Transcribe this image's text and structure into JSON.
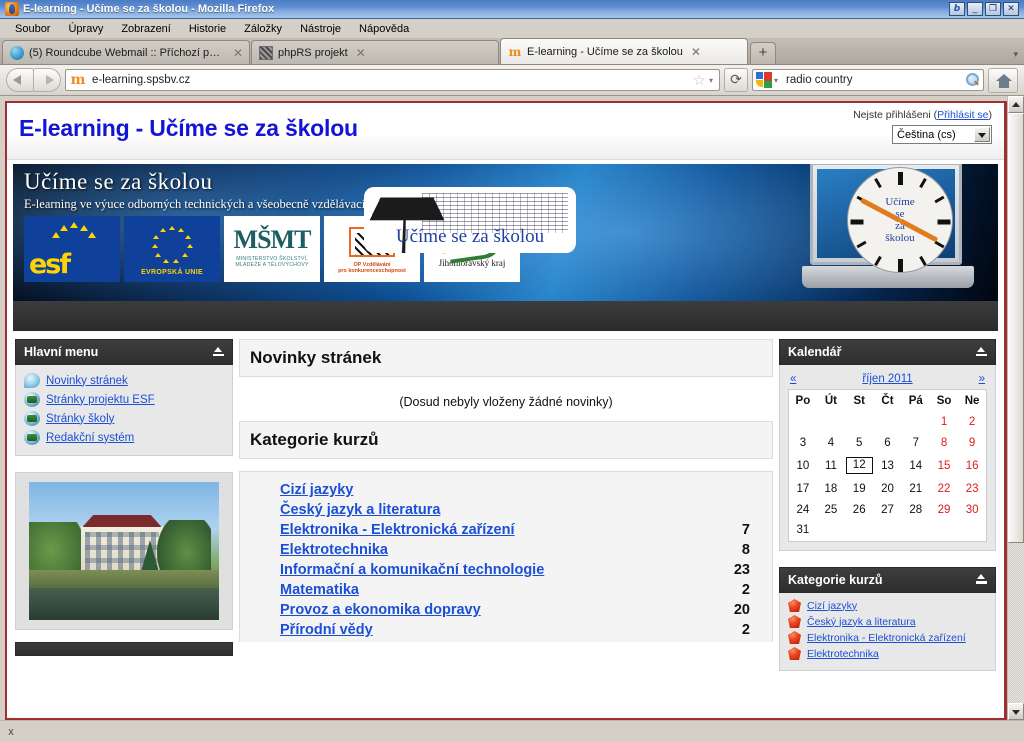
{
  "window": {
    "title": "E-learning - Učíme se za školou - Mozilla Firefox",
    "icon": "firefox-icon",
    "buttons": {
      "extra": "b",
      "minimize": "_",
      "restore": "❐",
      "close": "✕"
    }
  },
  "menubar": [
    {
      "label": "Soubor",
      "name": "menu-soubor"
    },
    {
      "label": "Úpravy",
      "name": "menu-upravy"
    },
    {
      "label": "Zobrazení",
      "name": "menu-zobrazeni"
    },
    {
      "label": "Historie",
      "name": "menu-historie"
    },
    {
      "label": "Záložky",
      "name": "menu-zalozky"
    },
    {
      "label": "Nástroje",
      "name": "menu-nastroje"
    },
    {
      "label": "Nápověda",
      "name": "menu-napoveda"
    }
  ],
  "tabs": [
    {
      "label": "(5) Roundcube Webmail :: Příchozí pošta",
      "active": false,
      "favicon": "roundcube-icon",
      "close": "✕"
    },
    {
      "label": "phpRS projekt",
      "active": false,
      "favicon": "phprs-icon",
      "close": "✕"
    },
    {
      "label": "E-learning - Učíme se za školou",
      "active": true,
      "favicon": "moodle-icon",
      "close": "✕"
    }
  ],
  "tabstrip": {
    "new_tab": "+",
    "list_all": "▾"
  },
  "toolbar": {
    "back": "◀",
    "forward": "▶",
    "url": "e-learning.spsbv.cz",
    "url_highlight": "spsbv.cz",
    "bookmark_star": "☆",
    "bookmark_caret": "▾",
    "reload": "⟳",
    "search_engine": "google-icon",
    "search_value": "radio country",
    "search_caret": "▾",
    "home": "home-icon"
  },
  "page": {
    "header": {
      "site_name": "E-learning - Učíme se za školou",
      "login_text": "Nejste přihlášeni (",
      "login_link": "Přihlásit se",
      "login_text_end": ")",
      "language": "Čeština (cs)",
      "language_caret": "▾"
    },
    "banner": {
      "title": "Učíme se za školou",
      "subtitle": "E-learning ve výuce odborných technických a všeobecně vzdělávacích předmětů na střední škole",
      "logos": [
        {
          "name": "esf-logo",
          "text": "esf"
        },
        {
          "name": "eu-logo",
          "text": "EVROPSKÁ UNIE"
        },
        {
          "name": "msmt-logo",
          "line1": "MINISTERSTVO ŠKOLSTVÍ,",
          "line2": "MLÁDEŽE A TĚLOVÝCHOVY",
          "mark": "MŠMT"
        },
        {
          "name": "opvk-logo",
          "line1": "OP Vzdělávání",
          "line2": "pro konkurenceschopnost"
        },
        {
          "name": "jmk-logo",
          "text": "Jihomoravský kraj"
        }
      ],
      "plaque_text": "Učíme se za školou",
      "clock_lines": [
        "Učíme",
        "se",
        "za",
        "školou"
      ]
    },
    "main_menu_block": {
      "title": "Hlavní menu",
      "dock": "dock-icon",
      "items": [
        {
          "label": "Novinky stránek",
          "icon": "news-icon"
        },
        {
          "label": "Stránky projektu ESF",
          "icon": "link-icon"
        },
        {
          "label": "Stránky školy",
          "icon": "link-icon"
        },
        {
          "label": "Redakční systém",
          "icon": "link-icon"
        }
      ]
    },
    "photo_block": {
      "alt": "school-photo"
    },
    "partial_block": {
      "title": ""
    },
    "news": {
      "title": "Novinky stránek",
      "empty_text": "(Dosud nebyly vloženy žádné novinky)"
    },
    "categories": {
      "title": "Kategorie kurzů",
      "rows": [
        {
          "label": "Cizí jazyky",
          "count": ""
        },
        {
          "label": "Český jazyk a literatura",
          "count": ""
        },
        {
          "label": "Elektronika - Elektronická zařízení",
          "count": "7"
        },
        {
          "label": "Elektrotechnika",
          "count": "8"
        },
        {
          "label": "Informační a komunikační technologie",
          "count": "23"
        },
        {
          "label": "Matematika",
          "count": "2"
        },
        {
          "label": "Provoz a ekonomika dopravy",
          "count": "20"
        },
        {
          "label": "Přírodní vědy",
          "count": "2"
        }
      ]
    },
    "calendar": {
      "title": "Kalendář",
      "dock": "dock-icon",
      "prev": "«",
      "next": "»",
      "month_label": "říjen 2011",
      "weekdays": [
        "Po",
        "Út",
        "St",
        "Čt",
        "Pá",
        "So",
        "Ne"
      ],
      "weeks": [
        [
          "",
          "",
          "",
          "",
          "",
          "1",
          "2"
        ],
        [
          "3",
          "4",
          "5",
          "6",
          "7",
          "8",
          "9"
        ],
        [
          "10",
          "11",
          "12",
          "13",
          "14",
          "15",
          "16"
        ],
        [
          "17",
          "18",
          "19",
          "20",
          "21",
          "22",
          "23"
        ],
        [
          "24",
          "25",
          "26",
          "27",
          "28",
          "29",
          "30"
        ],
        [
          "31",
          "",
          "",
          "",
          "",
          "",
          ""
        ]
      ],
      "today": "12",
      "weekend_columns": [
        5,
        6
      ]
    },
    "category_block": {
      "title": "Kategorie kurzů",
      "dock": "dock-icon",
      "items": [
        {
          "label": "Cizí jazyky",
          "icon": "gem-icon"
        },
        {
          "label": "Český jazyk a literatura",
          "icon": "gem-icon"
        },
        {
          "label": "Elektronika - Elektronická zařízení",
          "icon": "gem-icon"
        },
        {
          "label": "Elektrotechnika",
          "icon": "gem-icon"
        }
      ]
    }
  },
  "findbar": {
    "close": "x"
  },
  "scrollbar": {
    "up": "▲",
    "down": "▼"
  },
  "colors": {
    "title_blue": "#1414d6",
    "link_blue": "#1a4fd6",
    "block_header": "#2e2e2e",
    "weekend_red": "#e01b1b",
    "page_border": "#a03030"
  }
}
